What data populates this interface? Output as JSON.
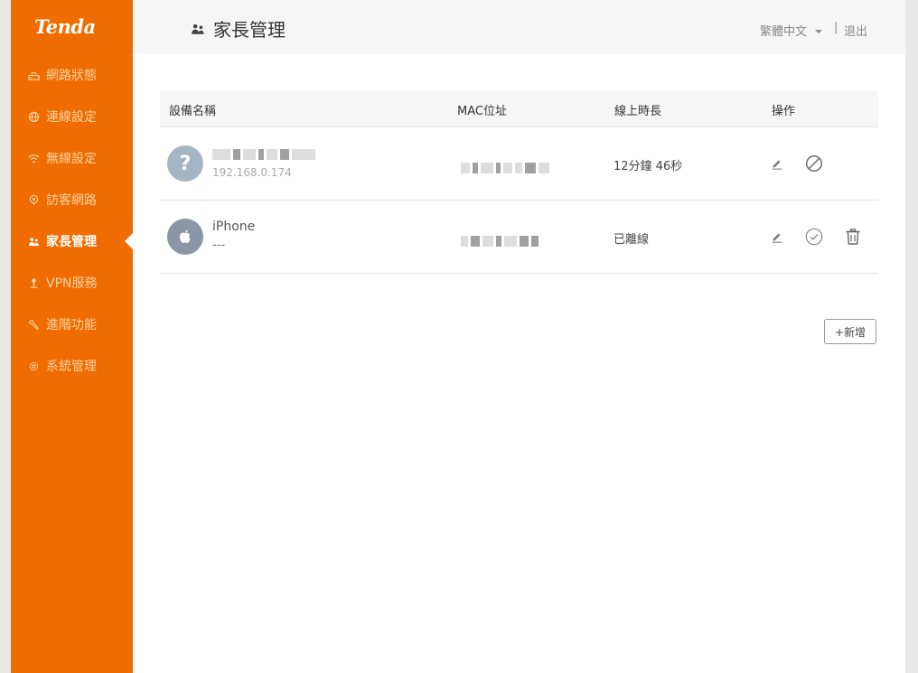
{
  "sidebar": {
    "logo": "Tenda",
    "items": [
      {
        "label": "網路狀態",
        "icon": "router-icon",
        "active": false
      },
      {
        "label": "連線設定",
        "icon": "globe-icon",
        "active": false
      },
      {
        "label": "無線設定",
        "icon": "wifi-icon",
        "active": false
      },
      {
        "label": "訪客網路",
        "icon": "guest-icon",
        "active": false
      },
      {
        "label": "家長管理",
        "icon": "parental-icon",
        "active": true
      },
      {
        "label": "VPN服務",
        "icon": "vpn-icon",
        "active": false
      },
      {
        "label": "進階功能",
        "icon": "wrench-icon",
        "active": false
      },
      {
        "label": "系統管理",
        "icon": "gear-icon",
        "active": false
      }
    ]
  },
  "header": {
    "title": "家長管理",
    "title_icon": "parental-icon",
    "language": "繁體中文",
    "separator": "|",
    "logout": "退出"
  },
  "table": {
    "columns": [
      "設備名稱",
      "MAC位址",
      "線上時長",
      "操作"
    ],
    "rows": [
      {
        "avatar": "?",
        "avatar_icon": "question-icon",
        "name": "",
        "sub": "192.168.0.174",
        "mac": "",
        "duration": "12分鐘 46秒",
        "actions": [
          "edit-icon",
          "block-icon"
        ]
      },
      {
        "avatar": "",
        "avatar_icon": "apple-icon",
        "name": "iPhone",
        "sub": "---",
        "mac": "",
        "duration": "已離線",
        "actions": [
          "edit-icon",
          "check-circle-icon",
          "trash-icon"
        ]
      }
    ]
  },
  "add_button": "+新增",
  "colors": {
    "accent": "#ef6c00",
    "sidebar_text": "#ffd2a6"
  }
}
